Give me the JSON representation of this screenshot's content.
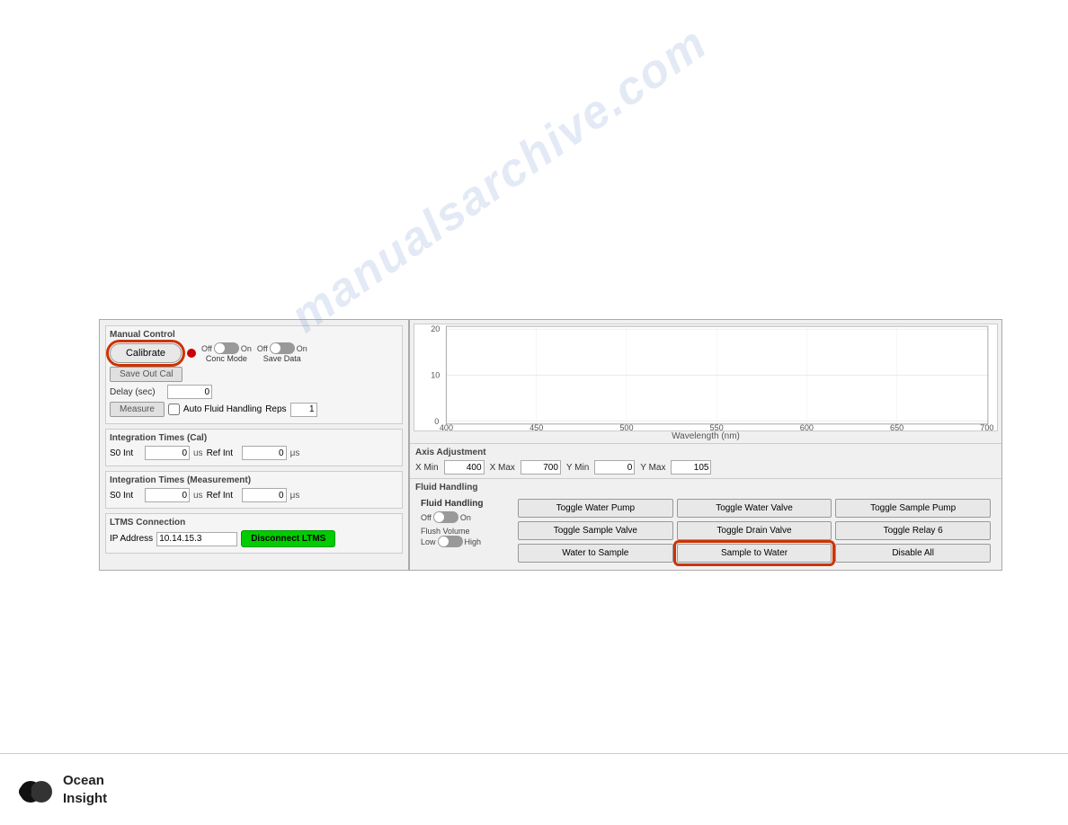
{
  "watermark": "manualsarchive.com",
  "manual_control": {
    "title": "Manual Control",
    "calibrate_label": "Calibrate",
    "save_out_cal_label": "Save Out Cal",
    "measure_label": "Measure",
    "conc_mode": {
      "off_label": "Off",
      "on_label": "On",
      "caption": "Conc Mode"
    },
    "save_data": {
      "off_label": "Off",
      "on_label": "On",
      "caption": "Save Data"
    },
    "delay_label": "Delay (sec)",
    "delay_value": "0",
    "auto_fluid_label": "Auto Fluid Handling",
    "reps_label": "Reps",
    "reps_value": "1"
  },
  "integration_cal": {
    "title": "Integration Times (Cal)",
    "s0_int_label": "S0 Int",
    "s0_int_value": "0",
    "s0_int_unit": "us",
    "ref_int_label": "Ref Int",
    "ref_int_value": "0",
    "ref_int_unit": "μs"
  },
  "integration_meas": {
    "title": "Integration Times (Measurement)",
    "s0_int_label": "S0 Int",
    "s0_int_value": "0",
    "s0_int_unit": "us",
    "ref_int_label": "Ref Int",
    "ref_int_value": "0",
    "ref_int_unit": "μs"
  },
  "ltms_connection": {
    "title": "LTMS Connection",
    "ip_label": "IP Address",
    "ip_value": "10.14.15.3",
    "disconnect_label": "Disconnect LTMS"
  },
  "chart": {
    "y_axis_values": [
      "20",
      "10",
      "0"
    ],
    "x_axis_values": [
      "400",
      "450",
      "500",
      "550",
      "600",
      "650",
      "700"
    ],
    "x_axis_label": "Wavelength (nm)"
  },
  "axis_adjustment": {
    "title": "Axis Adjustment",
    "x_min_label": "X Min",
    "x_min_value": "400",
    "x_max_label": "X Max",
    "x_max_value": "700",
    "y_min_label": "Y Min",
    "y_min_value": "0",
    "y_max_label": "Y Max",
    "y_max_value": "105"
  },
  "fluid_handling": {
    "title": "Fluid Handling",
    "fluid_handling_label": "Fluid Handling",
    "off_label": "Off",
    "on_label": "On",
    "flush_volume_label": "Flush Volume",
    "low_label": "Low",
    "high_label": "High",
    "buttons": [
      "Toggle Water Pump",
      "Toggle Water Valve",
      "Toggle Sample Pump",
      "Toggle Sample Valve",
      "Toggle Drain Valve",
      "Toggle Relay 6",
      "Water to Sample",
      "Sample to Water",
      "Disable All"
    ]
  },
  "footer": {
    "company_line1": "Ocean",
    "company_line2": "Insight"
  }
}
